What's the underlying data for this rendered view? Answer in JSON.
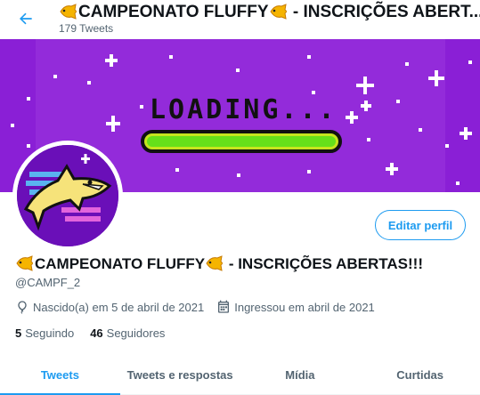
{
  "header": {
    "back_icon": "arrow-left-icon",
    "title": "CAMPEONATO FLUFFY",
    "title_suffix": " - INSCRIÇÕES ABERT...",
    "tweet_count": "179 Tweets"
  },
  "banner": {
    "loading_text": "LOADING...",
    "colors": {
      "background": "#8a1fd6",
      "bar_fill": "#66e01a"
    }
  },
  "profile": {
    "edit_button": "Editar perfil",
    "name": "CAMPEONATO FLUFFY",
    "name_suffix": " - INSCRIÇÕES ABERTAS!!!",
    "handle": "@CAMPF_2",
    "birth": "Nascido(a) em 5 de abril de 2021",
    "joined": "Ingressou em abril de 2021",
    "following_count": "5",
    "following_label": "Seguindo",
    "followers_count": "46",
    "followers_label": "Seguidores"
  },
  "tabs": [
    {
      "label": "Tweets",
      "active": true
    },
    {
      "label": "Tweets e respostas",
      "active": false
    },
    {
      "label": "Mídia",
      "active": false
    },
    {
      "label": "Curtidas",
      "active": false
    }
  ],
  "colors": {
    "accent": "#1d9bf0",
    "muted": "#536471"
  }
}
